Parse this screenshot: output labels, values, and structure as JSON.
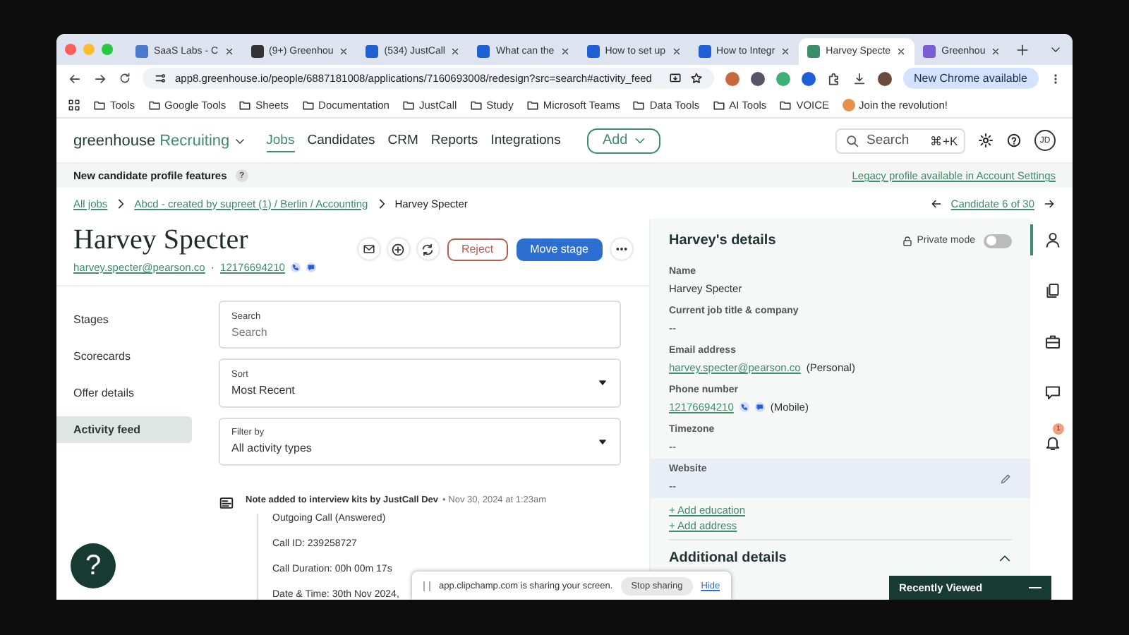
{
  "browser": {
    "tabs": [
      {
        "title": "SaaS Labs - C",
        "selected": false,
        "color": "#4a7bd0"
      },
      {
        "title": "(9+) Greenhou",
        "selected": false,
        "color": "#333333"
      },
      {
        "title": "(534) JustCall",
        "selected": false,
        "color": "#1f5fd6"
      },
      {
        "title": "What can the",
        "selected": false,
        "color": "#1f5fd6"
      },
      {
        "title": "How to set up",
        "selected": false,
        "color": "#1f5fd6"
      },
      {
        "title": "How to Integr",
        "selected": false,
        "color": "#1f5fd6"
      },
      {
        "title": "Harvey Specte",
        "selected": true,
        "color": "#3a8f6a"
      },
      {
        "title": "Greenhou",
        "selected": false,
        "color": "#7a5cd6"
      }
    ],
    "url": "app8.greenhouse.io/people/6887181008/applications/7160693008/redesign?src=search#activity_feed",
    "update_button": "New Chrome available",
    "bookmarks": [
      "Tools",
      "Google Tools",
      "Sheets",
      "Documentation",
      "JustCall",
      "Study",
      "Microsoft Teams",
      "Data Tools",
      "AI Tools",
      "VOICE",
      "Join the revolution!"
    ]
  },
  "app": {
    "brand": "greenhouse",
    "product": "Recruiting",
    "nav": [
      {
        "label": "Jobs",
        "selected": true
      },
      {
        "label": "Candidates",
        "selected": false
      },
      {
        "label": "CRM",
        "selected": false
      },
      {
        "label": "Reports",
        "selected": false
      },
      {
        "label": "Integrations",
        "selected": false
      }
    ],
    "add_button": "Add",
    "search": {
      "placeholder": "Search",
      "shortcut": "⌘+K"
    },
    "avatar": "JD"
  },
  "banner": {
    "title": "New candidate profile features",
    "help": "?",
    "link": "Legacy profile available in Account Settings"
  },
  "breadcrumb": {
    "links": [
      "All jobs",
      "Abcd - created by supreet (1) / Berlin / Accounting"
    ],
    "current": "Harvey Specter",
    "pager": "Candidate 6 of 30"
  },
  "candidate": {
    "name": "Harvey Specter",
    "email": "harvey.specter@pearson.co",
    "separator": "·",
    "phone": "12176694210",
    "reject": "Reject",
    "move_stage": "Move stage"
  },
  "side_nav": [
    {
      "label": "Stages",
      "selected": false
    },
    {
      "label": "Scorecards",
      "selected": false
    },
    {
      "label": "Offer details",
      "selected": false
    },
    {
      "label": "Activity feed",
      "selected": true
    }
  ],
  "filters": [
    {
      "kind": "text",
      "label": "Search",
      "placeholder": "Search"
    },
    {
      "kind": "select",
      "label": "Sort",
      "value": "Most Recent"
    },
    {
      "kind": "select",
      "label": "Filter by",
      "value": "All activity types"
    }
  ],
  "activity": {
    "title": "Note added to interview kits by JustCall Dev",
    "time": "• Nov 30, 2024 at 1:23am",
    "lines": [
      "Outgoing Call (Answered)",
      "Call ID: 239258727",
      "Call Duration: 00h 00m 17s",
      "Date & Time: 30th Nov 2024,"
    ]
  },
  "details": {
    "title": "Harvey's details",
    "private_mode": {
      "label": "Private mode",
      "on": false
    },
    "fields": [
      {
        "kind": "text",
        "label": "Name",
        "value": "Harvey Specter",
        "selected": false
      },
      {
        "kind": "text",
        "label": "Current job title & company",
        "value": "--",
        "selected": false
      },
      {
        "kind": "link",
        "label": "Email address",
        "value": "harvey.specter@pearson.co",
        "note": "(Personal)",
        "selected": false
      },
      {
        "kind": "phone",
        "label": "Phone number",
        "value": "12176694210",
        "note": "(Mobile)",
        "selected": false
      },
      {
        "kind": "text",
        "label": "Timezone",
        "value": "--",
        "selected": false
      },
      {
        "kind": "text",
        "label": "Website",
        "value": "--",
        "selected": true
      }
    ],
    "links": [
      "+ Add education",
      "+ Add address"
    ],
    "section": {
      "title": "Additional details",
      "expanded": true
    }
  },
  "rail": [
    {
      "kind": "person",
      "selected": true
    },
    {
      "kind": "documents",
      "selected": false
    },
    {
      "kind": "briefcase",
      "selected": false
    },
    {
      "kind": "chat",
      "selected": false
    },
    {
      "kind": "bell",
      "selected": false,
      "badge": "1"
    }
  ],
  "help_button": "?",
  "share_bar": {
    "message": "app.clipchamp.com is sharing your screen.",
    "stop": "Stop sharing",
    "hide": "Hide"
  },
  "recently_viewed": {
    "title": "Recently Viewed"
  }
}
